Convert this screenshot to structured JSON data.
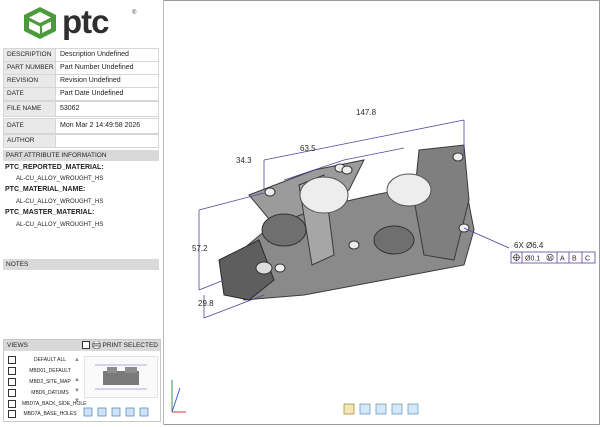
{
  "logo": {
    "text": "ptc",
    "reg": "®"
  },
  "properties": [
    {
      "key": "DESCRIPTION",
      "value": "Description Undefined"
    },
    {
      "key": "PART NUMBER",
      "value": "Part Number Undefined"
    },
    {
      "key": "REVISION",
      "value": "Revision Undefined"
    },
    {
      "key": "DATE",
      "value": "Part Date Undefined"
    }
  ],
  "file_info": [
    {
      "key": "FILE NAME",
      "value": "53062"
    },
    {
      "key": "DATE",
      "value": "Mon Mar  2 14:49:58 2026"
    },
    {
      "key": "AUTHOR",
      "value": ""
    }
  ],
  "attributes": {
    "header": "PART ATTRIBUTE INFORMATION",
    "items": [
      {
        "name": "PTC_REPORTED_MATERIAL:",
        "value": "AL-CU_ALLOY_WROUGHT_HS"
      },
      {
        "name": "PTC_MATERIAL_NAME:",
        "value": "AL-CU_ALLOY_WROUGHT_HS"
      },
      {
        "name": "PTC_MASTER_MATERIAL:",
        "value": "AL-CU_ALLOY_WROUGHT_HS"
      }
    ]
  },
  "notes": {
    "header": "NOTES"
  },
  "views": {
    "header": "VIEWS",
    "print_selected": "PRINT SELECTED",
    "items": [
      "DEFAULT ALL",
      "MBD01_DEFAULT",
      "MBD2_SITE_MAP",
      "MBD6_DATUMS",
      "MBD7A_BACK_SIDE_HOLE",
      "MBD7A_BASE_HOLES"
    ]
  },
  "dimensions": {
    "d1": "147.8",
    "d2": "63.5",
    "d3": "34.3",
    "d4": "57.2",
    "d5": "29.8",
    "hole_callout": "6X Ø6.4",
    "fcf_tol": "Ø0.1",
    "fcf_mod": "M",
    "datum_a": "A",
    "datum_b": "B",
    "datum_c": "C"
  },
  "colors": {
    "dimension": "#5a3fa0",
    "part": "#6e6e6e",
    "header_bg": "#d9d9d9"
  }
}
